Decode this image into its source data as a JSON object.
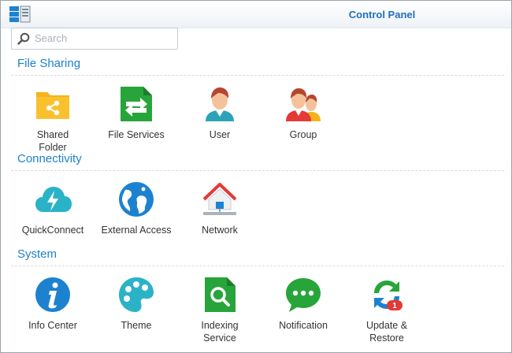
{
  "window": {
    "title": "Control Panel"
  },
  "search": {
    "placeholder": "Search",
    "value": ""
  },
  "sections": [
    {
      "title": "File Sharing",
      "items": [
        {
          "label": "Shared\nFolder",
          "icon": "shared-folder-icon"
        },
        {
          "label": "File Services",
          "icon": "file-services-icon"
        },
        {
          "label": "User",
          "icon": "user-icon"
        },
        {
          "label": "Group",
          "icon": "group-icon"
        }
      ]
    },
    {
      "title": "Connectivity",
      "items": [
        {
          "label": "QuickConnect",
          "icon": "quickconnect-icon"
        },
        {
          "label": "External Access",
          "icon": "external-access-icon"
        },
        {
          "label": "Network",
          "icon": "network-icon"
        }
      ]
    },
    {
      "title": "System",
      "items": [
        {
          "label": "Info Center",
          "icon": "info-center-icon"
        },
        {
          "label": "Theme",
          "icon": "theme-icon"
        },
        {
          "label": "Indexing\nService",
          "icon": "indexing-service-icon"
        },
        {
          "label": "Notification",
          "icon": "notification-icon"
        },
        {
          "label": "Update &\nRestore",
          "icon": "update-restore-icon",
          "badge": "1"
        }
      ]
    }
  ],
  "colors": {
    "accent": "#1c82d0",
    "title": "#1f6fbd",
    "folder": "#f4b41a",
    "green": "#27a53a",
    "red_badge": "#e53935"
  }
}
